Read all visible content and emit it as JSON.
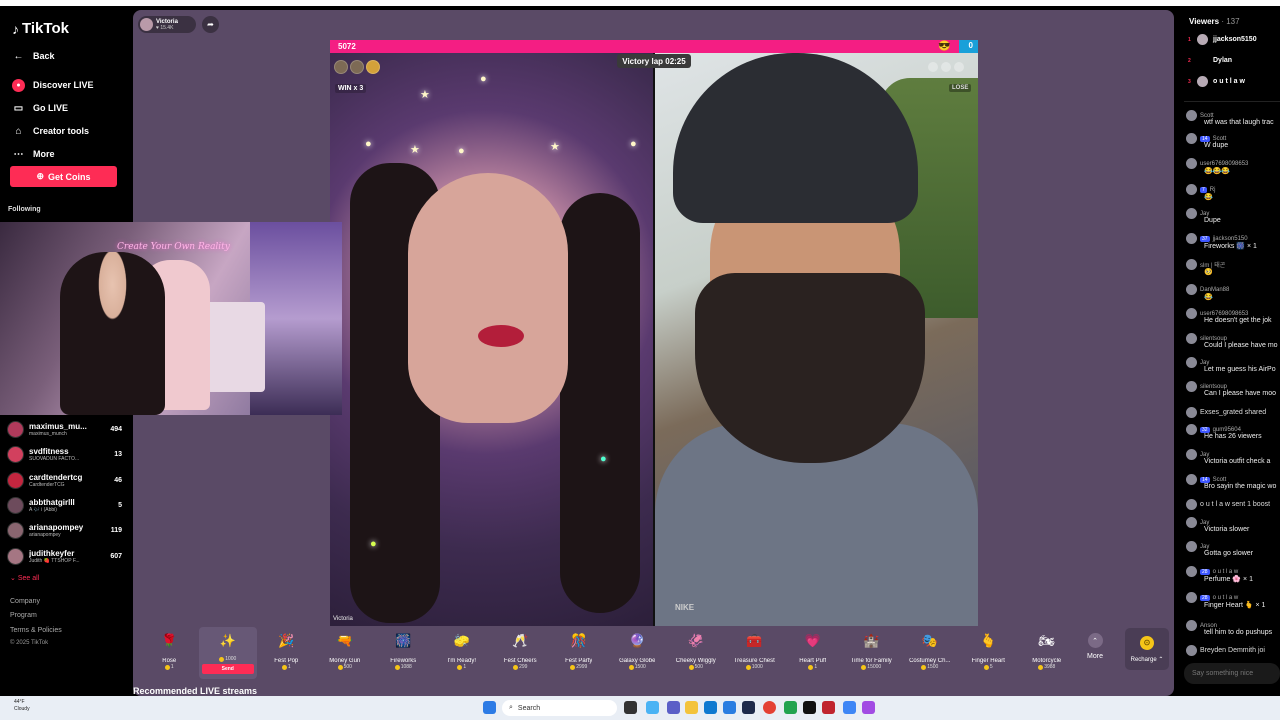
{
  "sidebar": {
    "logo": "TikTok",
    "nav": [
      {
        "label": "Back",
        "icon": "arrow-left-icon"
      },
      {
        "label": "Discover LIVE",
        "icon": "live-icon"
      },
      {
        "label": "Go LIVE",
        "icon": "camera-icon"
      },
      {
        "label": "Creator tools",
        "icon": "home-icon"
      },
      {
        "label": "More",
        "icon": "ellipsis-icon"
      }
    ],
    "get_coins": "Get Coins",
    "following_label": "Following",
    "following": [
      {
        "name": "maximus_mu...",
        "sub": "maximus_munch",
        "count": "494"
      },
      {
        "name": "svdfitness",
        "sub": "SUOVADUN FACTO...",
        "count": "13"
      },
      {
        "name": "cardtendertcg",
        "sub": "CardtenderTCG",
        "count": "46"
      },
      {
        "name": "abbthatgirlll",
        "sub": "A 🎶 i (Abbi)",
        "count": "5"
      },
      {
        "name": "arianapompey",
        "sub": "arianapompey",
        "count": "119"
      },
      {
        "name": "judithkeyfer",
        "sub": "Judith 🍓 TTSHOP F...",
        "count": "607"
      }
    ],
    "see_all": "See all",
    "footer": [
      "Company",
      "Program",
      "Terms & Policies"
    ],
    "copyright": "© 2025 TikTok"
  },
  "webcam": {
    "sign": "Create Your Own Reality"
  },
  "stream": {
    "host_name": "Victoria",
    "host_likes": "♥ 15.4K",
    "score_left": "5072",
    "score_right": "0",
    "timer": "Victory lap 02:25",
    "win_label": "WIN x 3",
    "lose_label": "LOSE",
    "left_cam_label": "Victoria"
  },
  "gifts": [
    {
      "name": "Rose",
      "price": "1",
      "icon": "🌹"
    },
    {
      "name": "",
      "price": "1000",
      "icon": "✨",
      "selected": true,
      "send": "Send"
    },
    {
      "name": "Fest Pop",
      "price": "1",
      "icon": "🎉"
    },
    {
      "name": "Money Gun",
      "price": "500",
      "icon": "🔫"
    },
    {
      "name": "Fireworks",
      "price": "1088",
      "icon": "🎆"
    },
    {
      "name": "I'm Ready!",
      "price": "1",
      "icon": "🧽"
    },
    {
      "name": "Fest Cheers",
      "price": "299",
      "icon": "🥂"
    },
    {
      "name": "Fest Party",
      "price": "2999",
      "icon": "🎊"
    },
    {
      "name": "Galaxy Globe",
      "price": "1500",
      "icon": "🔮"
    },
    {
      "name": "Cheeky Wiggly",
      "price": "500",
      "icon": "🦑"
    },
    {
      "name": "Treasure Chest",
      "price": "1000",
      "icon": "🧰"
    },
    {
      "name": "Heart Puff",
      "price": "1",
      "icon": "💗"
    },
    {
      "name": "Time for Family",
      "price": "15000",
      "icon": "🏰"
    },
    {
      "name": "Costumey Ch...",
      "price": "1500",
      "icon": "🎭"
    },
    {
      "name": "Finger Heart",
      "price": "5",
      "icon": "🫰"
    },
    {
      "name": "Motorcycle",
      "price": "3988",
      "icon": "🏍"
    }
  ],
  "more_label": "More",
  "recharge_label": "Recharge",
  "recommended": "Recommended LIVE streams",
  "chat": {
    "viewers_title": "Viewers",
    "viewers_count": "· 137",
    "top_viewers": [
      "jjackson5150",
      "Dylan",
      "o u t l a w"
    ],
    "messages": [
      {
        "user": "Scott",
        "badge": "",
        "text": "wtf was that laugh trac"
      },
      {
        "user": "Scott",
        "badge": "14",
        "text": "W dupe"
      },
      {
        "user": "user67698098653",
        "badge": "",
        "text": "😂😂😂"
      },
      {
        "user": "Rj",
        "badge": "7",
        "text": "😂"
      },
      {
        "user": "Jay",
        "badge": "",
        "text": "Dupe"
      },
      {
        "user": "jjackson5150",
        "badge": "37",
        "text": "Fireworks 🎆 × 1"
      },
      {
        "user": "slm | 태곤",
        "badge": "",
        "text": "🥺"
      },
      {
        "user": "DanMan88",
        "badge": "",
        "text": "😂"
      },
      {
        "user": "user67698098653",
        "badge": "",
        "text": "He doesn't get the jok"
      },
      {
        "user": "silentsoup",
        "badge": "",
        "text": "Could I please have mo"
      },
      {
        "user": "Jay",
        "badge": "",
        "text": "Let me guess his AirPo"
      },
      {
        "user": "silentsoup",
        "badge": "",
        "text": "Can I please have moo"
      },
      {
        "user": "Exses_grated shared",
        "badge": "",
        "text": ""
      },
      {
        "user": "gum95604",
        "badge": "32",
        "text": "He has 26 viewers"
      },
      {
        "user": "Jay",
        "badge": "",
        "text": "Victoria outfit check a"
      },
      {
        "user": "Scott",
        "badge": "14",
        "text": "Bro sayin the magic wo"
      },
      {
        "user": "o u t l a w sent 1 boost",
        "badge": "",
        "text": ""
      },
      {
        "user": "Jay",
        "badge": "",
        "text": "Victoria slower"
      },
      {
        "user": "Jay",
        "badge": "",
        "text": "Gotta go slower"
      },
      {
        "user": "o u t l a w",
        "badge": "28",
        "text": "Perfume 🌸 × 1"
      },
      {
        "user": "o u t l a w",
        "badge": "28",
        "text": "Finger Heart 🫰 × 1"
      },
      {
        "user": "Anson",
        "badge": "",
        "text": "tell him to do pushups"
      },
      {
        "user": "Breyden Demmith joi",
        "badge": "",
        "text": ""
      }
    ],
    "input_placeholder": "Say something nice"
  },
  "taskbar": {
    "temp": "44°F",
    "condition": "Cloudy",
    "search_placeholder": "Search"
  }
}
